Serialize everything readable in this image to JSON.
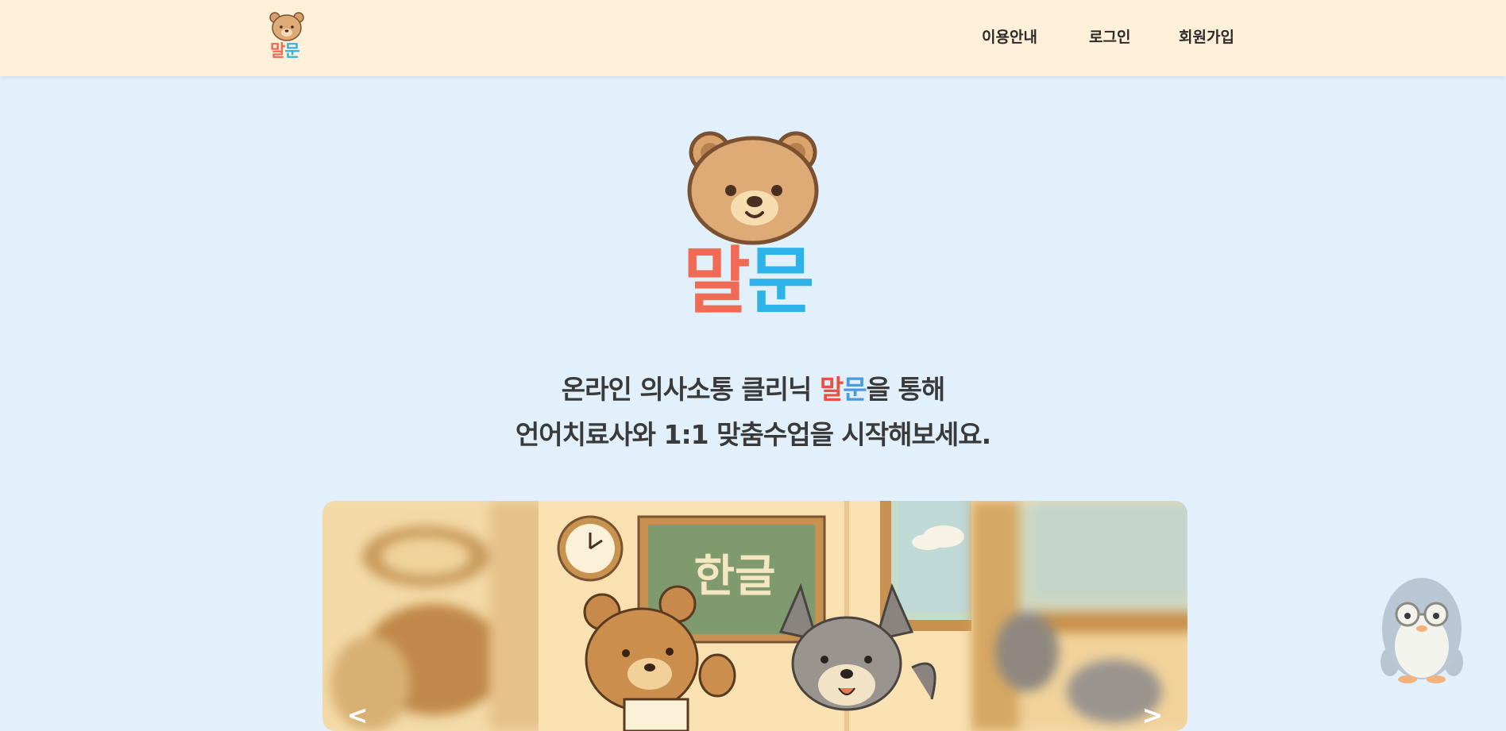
{
  "header": {
    "logo": {
      "char1": "말",
      "char2": "문"
    },
    "nav": {
      "guide": "이용안내",
      "login": "로그인",
      "signup": "회원가입"
    }
  },
  "hero": {
    "logo": {
      "char1": "말",
      "char2": "문"
    },
    "tagline": {
      "line1_before": "온라인 의사소통 클리닉 ",
      "brand1": "말",
      "brand2": "문",
      "line1_after": "을 통해",
      "line2": "언어치료사와 1:1 맞춤수업을 시작해보세요."
    }
  },
  "carousel": {
    "current_slide_text": "한글",
    "prev_label": "<",
    "next_label": ">"
  },
  "colors": {
    "header_bg": "#fff0d9",
    "page_bg": "#e2f0fb",
    "brand_red": "#f06a54",
    "brand_blue": "#2eb3e8"
  }
}
